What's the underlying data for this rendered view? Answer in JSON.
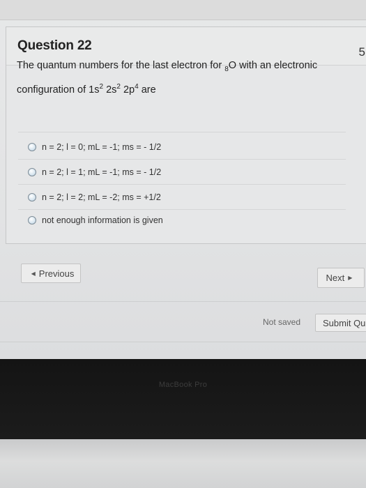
{
  "question": {
    "title": "Question 22",
    "points": "5",
    "prompt": {
      "text_before": "The quantum numbers for the last electron for ",
      "element_subscript": "8",
      "element_symbol": "O",
      "text_middle": " with an electronic configuration of 1s",
      "sup1": "2",
      "text_2s": " 2s",
      "sup2": "2",
      "text_2p": " 2p",
      "sup3": "4",
      "text_after": " are"
    },
    "options": [
      {
        "label": "n = 2; l = 0; mL = -1; ms = - 1/2"
      },
      {
        "label": "n = 2; l = 1; mL = -1; ms = - 1/2"
      },
      {
        "label": "n = 2; l = 2; mL = -2; ms = +1/2"
      },
      {
        "label": "not enough information is given"
      }
    ]
  },
  "navigation": {
    "previous_label": "Previous",
    "next_label": "Next"
  },
  "footer": {
    "status": "Not saved",
    "submit_label": "Submit Qu"
  },
  "device": {
    "brand": "MacBook Pro"
  }
}
